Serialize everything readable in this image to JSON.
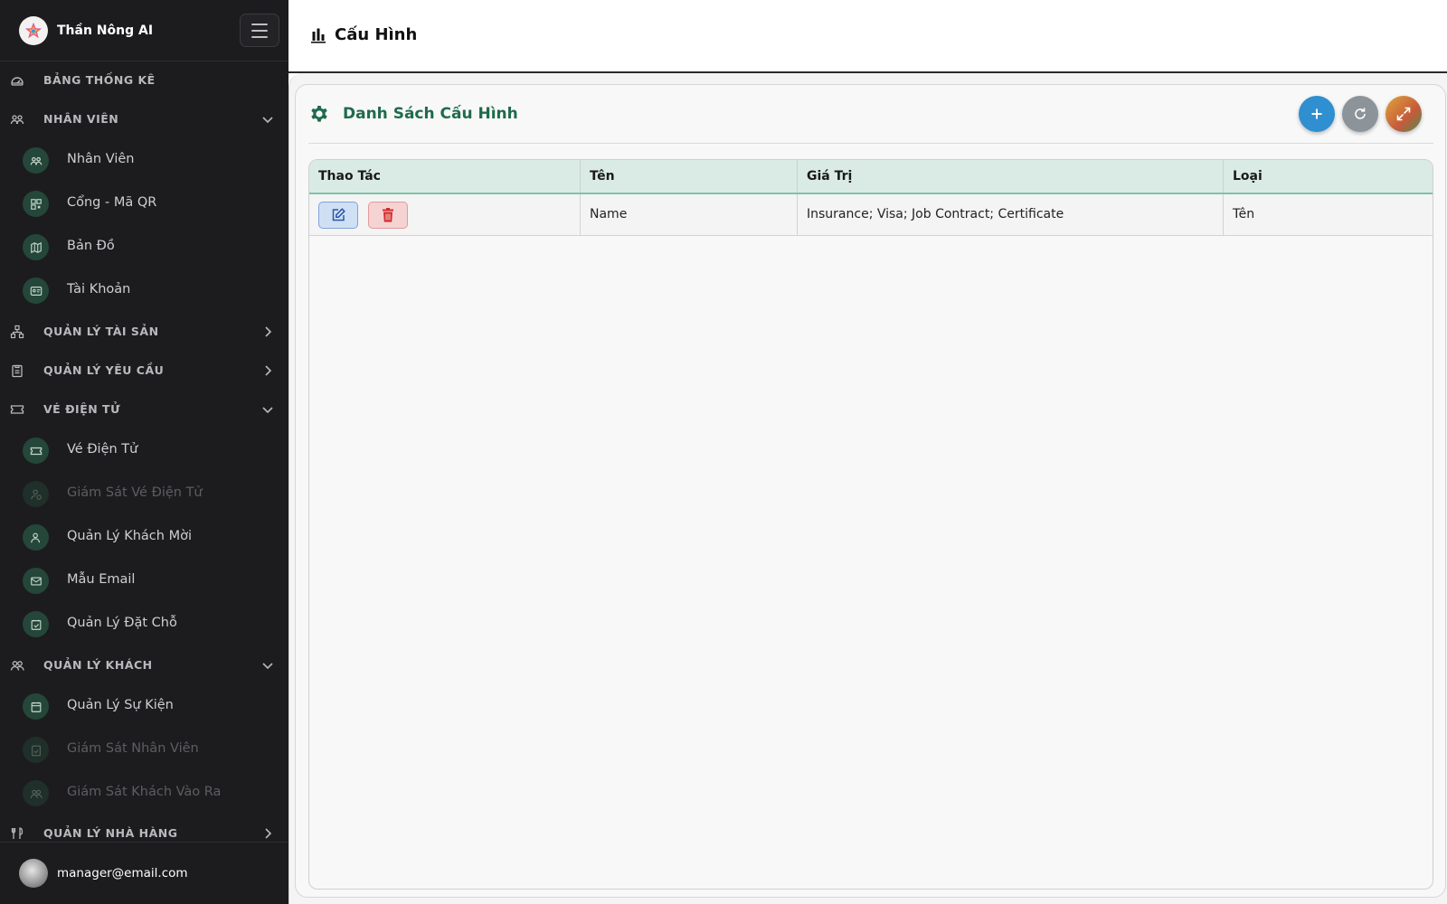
{
  "app": {
    "name": "Thần Nông AI"
  },
  "sidebar": {
    "sections": [
      {
        "label": "BẢNG THỐNG KÊ",
        "icon": "dashboard-icon"
      },
      {
        "label": "NHÂN VIÊN",
        "icon": "people-icon",
        "expanded": true
      },
      {
        "label": "QUẢN LÝ TÀI SẢN",
        "icon": "hierarchy-icon",
        "expanded": false
      },
      {
        "label": "QUẢN LÝ YÊU CẦU",
        "icon": "clipboard-icon",
        "expanded": false
      },
      {
        "label": "VÉ ĐIỆN TỬ",
        "icon": "ticket-icon",
        "expanded": true
      },
      {
        "label": "QUẢN LÝ KHÁCH",
        "icon": "users-icon",
        "expanded": true
      },
      {
        "label": "QUẢN LÝ NHÀ HÀNG",
        "icon": "restaurant-icon",
        "expanded": false
      }
    ],
    "items": [
      {
        "label": "Nhân Viên",
        "icon": "people-icon"
      },
      {
        "label": "Cổng - Mã QR",
        "icon": "qr-icon"
      },
      {
        "label": "Bản Đồ",
        "icon": "map-icon"
      },
      {
        "label": "Tài Khoản",
        "icon": "id-card-icon"
      },
      {
        "label": "Vé Điện Tử",
        "icon": "ticket-icon"
      },
      {
        "label": "Giám Sát Vé Điện Tử",
        "icon": "user-check-icon",
        "disabled": true
      },
      {
        "label": "Quản Lý Khách Mời",
        "icon": "user-icon"
      },
      {
        "label": "Mẫu Email",
        "icon": "mail-icon"
      },
      {
        "label": "Quản Lý Đặt Chỗ",
        "icon": "calendar-check-icon"
      },
      {
        "label": "Quản Lý Sự Kiện",
        "icon": "calendar-icon"
      },
      {
        "label": "Giám Sát Nhân Viên",
        "icon": "clipboard-check-icon",
        "disabled": true
      },
      {
        "label": "Giám Sát Khách Vào Ra",
        "icon": "users-icon",
        "disabled": true
      }
    ],
    "user": {
      "email": "manager@email.com"
    }
  },
  "header": {
    "title": "Cấu Hình",
    "icon": "bar-chart-icon"
  },
  "card": {
    "title": "Danh Sách Cấu Hình",
    "icon": "gear-icon",
    "buttons": [
      "add-icon",
      "refresh-icon",
      "expand-icon"
    ]
  },
  "table": {
    "columns": [
      "Thao Tác",
      "Tên",
      "Giá Trị",
      "Loại"
    ],
    "rows": [
      {
        "name": "Name",
        "value": "Insurance; Visa; Job Contract; Certificate",
        "type": "Tên"
      }
    ]
  },
  "colors": {
    "sidebar_bg": "#1c1c1e",
    "accent_green": "#1f6b4c",
    "table_header_bg": "#d9ebe4",
    "add_button": "#2f8fd0",
    "delete_button": "#d42a2a"
  }
}
